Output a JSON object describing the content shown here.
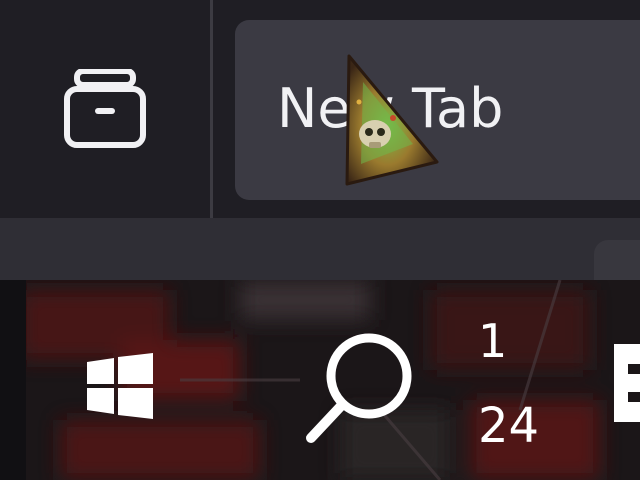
{
  "browser": {
    "tab_group_button": {
      "icon": "archive-box-icon"
    },
    "active_tab": {
      "title": "New Tab",
      "favicon": "cartoon-skull-triangle-icon"
    }
  },
  "taskbar": {
    "start_button": {
      "icon": "windows-logo-icon"
    },
    "search_button": {
      "icon": "search-icon"
    },
    "clock": {
      "line1": "1",
      "line2": "24"
    },
    "pinned_app": {
      "icon": "file-explorer-icon"
    }
  },
  "colors": {
    "tabstrip_bg": "#1f1e24",
    "tab_bg": "#3b3a43",
    "text": "#f1f1f4",
    "taskbar_tint": "#1a1517"
  }
}
